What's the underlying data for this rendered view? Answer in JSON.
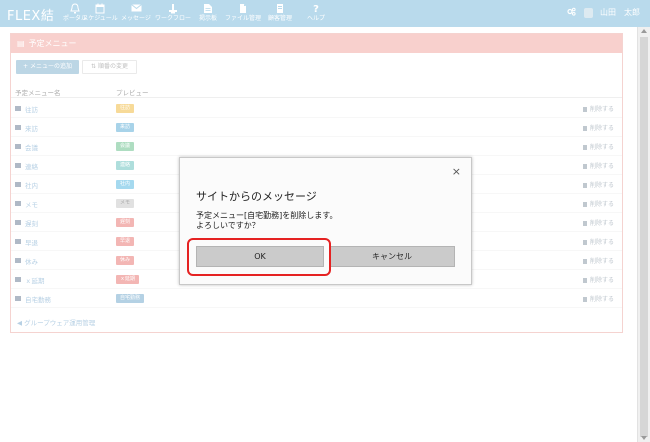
{
  "app": {
    "brand": "FLEX結"
  },
  "nav": [
    {
      "label": "ポータル",
      "icon": "bell-icon"
    },
    {
      "label": "スケジュール",
      "icon": "calendar-icon"
    },
    {
      "label": "メッセージ",
      "icon": "mail-icon"
    },
    {
      "label": "ワークフロー",
      "icon": "workflow-icon"
    },
    {
      "label": "掲示板",
      "icon": "board-icon"
    },
    {
      "label": "ファイル管理",
      "icon": "file-icon"
    },
    {
      "label": "顧客管理",
      "icon": "customer-icon"
    },
    {
      "label": "ヘルプ",
      "icon": "help-icon"
    }
  ],
  "user": {
    "name": "山田　太郎"
  },
  "panel": {
    "title": "予定メニュー",
    "add_button": "+ メニューの追加",
    "order_button": "⇅ 順番の変更",
    "col_name": "予定メニュー名",
    "col_preview": "プレビュー",
    "back_link": "グループウェア運用管理"
  },
  "rows": [
    {
      "name": "往訪",
      "badge": "往訪",
      "badge_color": "#f2c35a",
      "delete": "削除する"
    },
    {
      "name": "来訪",
      "badge": "来訪",
      "badge_color": "#73b8dc",
      "delete": "削除する"
    },
    {
      "name": "会議",
      "badge": "会議",
      "badge_color": "#7cc99b",
      "delete": "削除する"
    },
    {
      "name": "連絡",
      "badge": "連絡",
      "badge_color": "#7dcac7",
      "delete": "削除する"
    },
    {
      "name": "社内",
      "badge": "社内",
      "badge_color": "#6fc2e6",
      "delete": "削除する"
    },
    {
      "name": "メモ",
      "badge": "メモ",
      "badge_color": "#cfcfcf",
      "badge_text_color": "#777777",
      "delete": "削除する"
    },
    {
      "name": "遅刻",
      "badge": "遅刻",
      "badge_color": "#ec8a86",
      "delete": "削除する"
    },
    {
      "name": "早退",
      "badge": "早退",
      "badge_color": "#ec8a86",
      "delete": "削除する"
    },
    {
      "name": "休み",
      "badge": "休み",
      "badge_color": "#ec8a86",
      "delete": "削除する"
    },
    {
      "name": "ｘ延期",
      "badge": "ｘ延期",
      "badge_color": "#ec8a86",
      "delete": "削除する"
    },
    {
      "name": "自宅勤務",
      "badge": "自宅勤務",
      "badge_color": "#87b5d3",
      "delete": "削除する"
    }
  ],
  "dialog": {
    "close": "×",
    "title": "サイトからのメッセージ",
    "message_line1": "予定メニュー[自宅勤務]を削除します。",
    "message_line2": "よろしいですか？",
    "ok": "OK",
    "cancel": "キャンセル"
  }
}
